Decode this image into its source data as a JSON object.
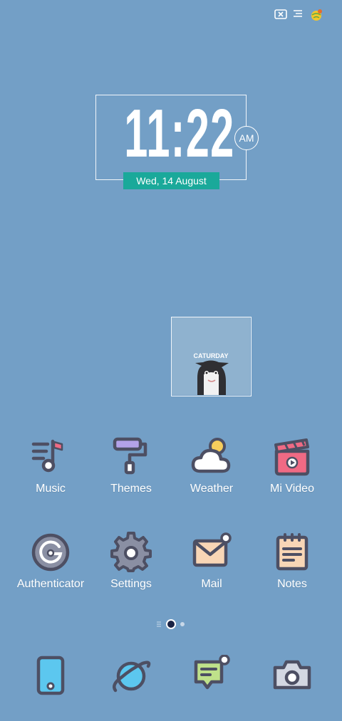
{
  "status_bar": {
    "icons": [
      "screen-close-icon",
      "menu-lines-icon",
      "globe-app-icon"
    ]
  },
  "clock": {
    "time": "11:22",
    "ampm": "AM",
    "date": "Wed, 14 August"
  },
  "photo_widget": {
    "caption": "CATURDAY"
  },
  "apps": {
    "row1": [
      {
        "label": "Music",
        "icon": "music-icon"
      },
      {
        "label": "Themes",
        "icon": "paint-roller-icon"
      },
      {
        "label": "Weather",
        "icon": "weather-cloud-sun-icon"
      },
      {
        "label": "Mi Video",
        "icon": "video-clapper-icon"
      }
    ],
    "row2": [
      {
        "label": "Authenticator",
        "icon": "authenticator-icon"
      },
      {
        "label": "Settings",
        "icon": "gear-icon"
      },
      {
        "label": "Mail",
        "icon": "mail-icon"
      },
      {
        "label": "Notes",
        "icon": "notes-icon"
      }
    ]
  },
  "pager": {
    "pages": 3,
    "current": 2
  },
  "dock": [
    "phone-icon",
    "browser-planet-icon",
    "messages-icon",
    "camera-icon"
  ],
  "colors": {
    "wallpaper": "#739fc6",
    "date_bg": "#1aa99a",
    "icon_outline": "#4d4f63",
    "accent_pink": "#f06a84",
    "accent_yellow": "#f6cd5c",
    "accent_purple": "#b3a2e8",
    "accent_blue": "#5cc7ef",
    "accent_green": "#bfe18a",
    "accent_peach": "#f8d6b6"
  }
}
